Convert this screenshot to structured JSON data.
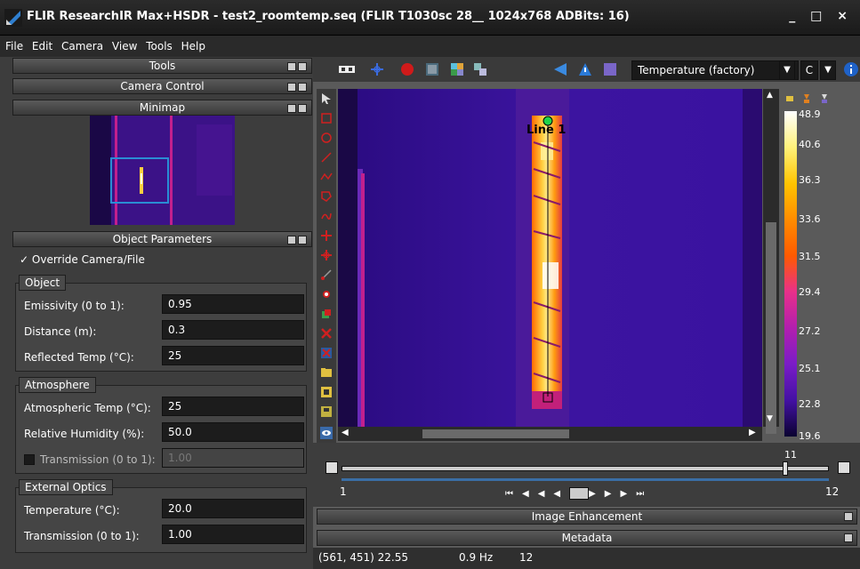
{
  "window": {
    "title": "FLIR ResearchIR Max+HSDR - test2_roomtemp.seq (FLIR T1030sc 28__ 1024x768 ADBits: 16)",
    "controls": "_ □ ×"
  },
  "menu": [
    "File",
    "Edit",
    "Camera",
    "View",
    "Tools",
    "Help"
  ],
  "left": {
    "tools_header": "Tools",
    "camera_control": "Camera Control",
    "minimap": "Minimap",
    "object_parameters": "Object Parameters",
    "override_label": "Override Camera/File",
    "object_group": {
      "label": "Object",
      "rows": [
        {
          "label": "Emissivity (0 to 1):",
          "value": "0.95"
        },
        {
          "label": "Distance (m):",
          "value": "0.3"
        },
        {
          "label": "Reflected Temp (°C):",
          "value": "25"
        }
      ]
    },
    "atmosphere_group": {
      "label": "Atmosphere",
      "rows": [
        {
          "label": "Atmospheric Temp (°C):",
          "value": "25"
        },
        {
          "label": "Relative Humidity (%):",
          "value": "50.0"
        },
        {
          "label": "Transmission (0 to 1):",
          "value": "1.00"
        }
      ]
    },
    "optics_group": {
      "label": "External Optics",
      "rows": [
        {
          "label": "Temperature (°C):",
          "value": "20.0"
        },
        {
          "label": "Transmission (0 to 1):",
          "value": "1.00"
        }
      ]
    }
  },
  "toolbar": {
    "temperature_mode": "Temperature (factory)",
    "unit": "C",
    "icons": [
      "filmstrip-icon",
      "crosshair-icon",
      "record-icon",
      "image-icon",
      "palette-icon",
      "compare-icon",
      "arrow-icon",
      "warning-icon",
      "box-icon",
      "info-icon"
    ]
  },
  "image": {
    "line_label": "Line 1"
  },
  "colorbar": {
    "labels": [
      "48.9",
      "40.6",
      "36.3",
      "33.6",
      "31.5",
      "29.4",
      "27.2",
      "25.1",
      "22.8",
      "19.6"
    ],
    "colors": [
      "#ffffff",
      "#fff27a",
      "#ffc400",
      "#ff8c00",
      "#ff5a00",
      "#e8308a",
      "#b21fae",
      "#7a1cc7",
      "#4311a3",
      "#0a0230"
    ]
  },
  "playback": {
    "start_frame": "1",
    "end_frame": "12",
    "current_frame": "11",
    "position": 0.91
  },
  "sections": {
    "image_enhancement": "Image Enhancement",
    "metadata": "Metadata"
  },
  "status": {
    "cursor": "(561, 451) 22.55",
    "rate": "0.9 Hz",
    "frame": "12"
  }
}
